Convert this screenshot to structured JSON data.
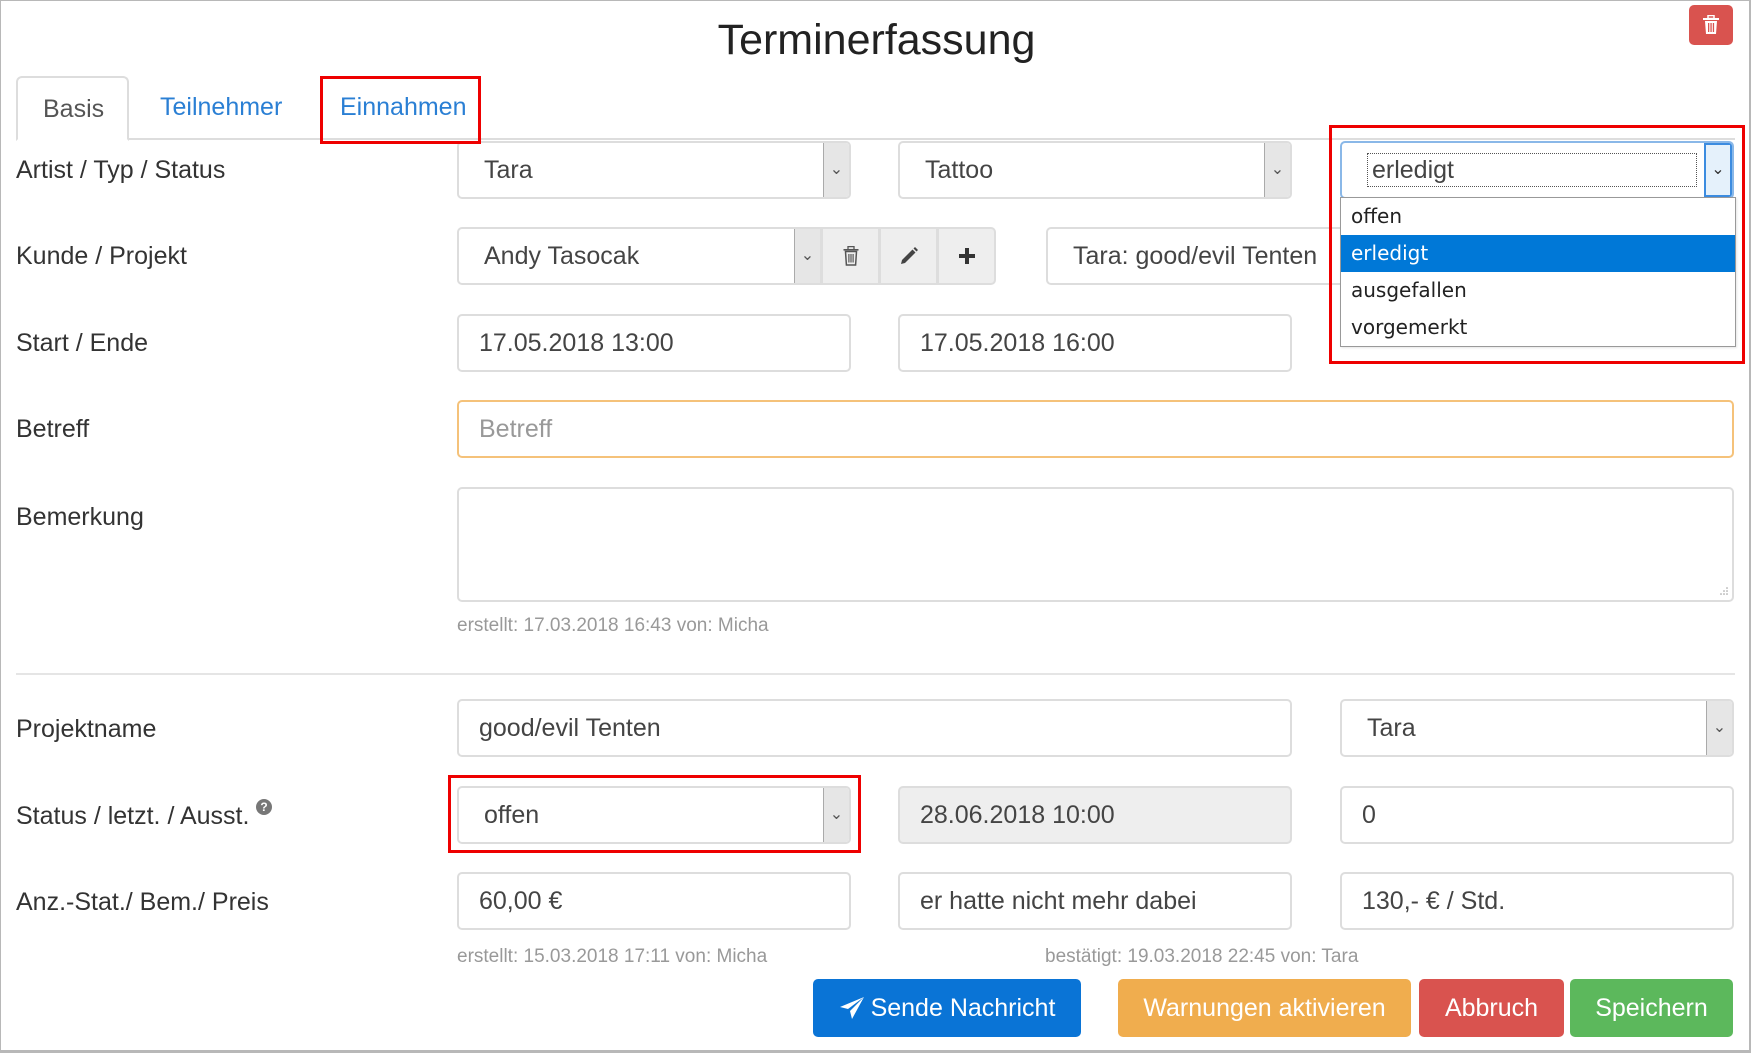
{
  "title": "Terminerfassung",
  "tabs": [
    {
      "label": "Basis",
      "active": true
    },
    {
      "label": "Teilnehmer",
      "active": false
    },
    {
      "label": "Einnahmen",
      "active": false
    }
  ],
  "rows": {
    "artist_typ_status": {
      "label": "Artist / Typ / Status",
      "artist": "Tara",
      "typ": "Tattoo",
      "status": "erledigt",
      "status_options": [
        "offen",
        "erledigt",
        "ausgefallen",
        "vorgemerkt"
      ],
      "status_selected_index": 1
    },
    "kunde_projekt": {
      "label": "Kunde / Projekt",
      "kunde": "Andy Tasocak",
      "projekt": "Tara: good/evil Tenten"
    },
    "start_ende": {
      "label": "Start / Ende",
      "start": "17.05.2018 13:00",
      "ende": "17.05.2018 16:00"
    },
    "betreff": {
      "label": "Betreff",
      "placeholder": "Betreff",
      "value": ""
    },
    "bemerkung": {
      "label": "Bemerkung",
      "value": "",
      "meta": "erstellt: 17.03.2018 16:43 von: Micha"
    },
    "projektname": {
      "label": "Projektname",
      "name": "good/evil Tenten",
      "artist": "Tara"
    },
    "status_letzt_ausst": {
      "label": "Status / letzt. / Ausst.",
      "status": "offen",
      "letzt": "28.06.2018 10:00",
      "ausst": "0"
    },
    "anz_bem_preis": {
      "label": "Anz.-Stat./ Bem./ Preis",
      "anzahlung": "60,00 €",
      "bemerkung": "er hatte nicht mehr dabei",
      "preis": "130,- € / Std."
    },
    "project_meta": {
      "erstellt": "erstellt: 15.03.2018 17:11 von: Micha",
      "bestaetigt": "bestätigt: 19.03.2018 22:45 von: Tara"
    }
  },
  "buttons": {
    "send": "Sende Nachricht",
    "warnings": "Warnungen aktivieren",
    "cancel": "Abbruch",
    "save": "Speichern"
  },
  "icons": {
    "delete_top": "trash-icon",
    "kunde_delete": "trash-icon",
    "kunde_edit": "pencil-icon",
    "kunde_add": "plus-icon",
    "send": "paper-plane-icon",
    "help": "question-circle-icon"
  },
  "colors": {
    "primary": "#0a74d6",
    "warning": "#f0ad4e",
    "danger": "#d9534f",
    "success": "#5cb85c",
    "highlight": "#0078d7",
    "annotation": "#e00000"
  }
}
